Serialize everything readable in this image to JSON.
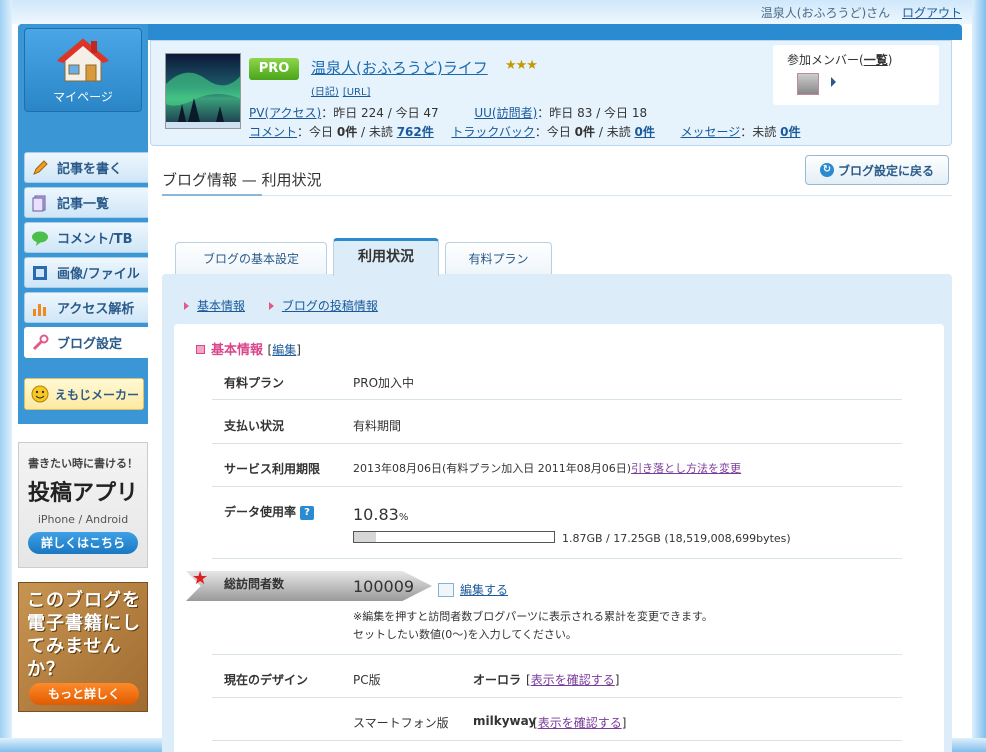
{
  "user": {
    "name": "温泉人(おふろうど)さん",
    "logout": "ログアウト"
  },
  "sidebar": {
    "mypage": "マイページ",
    "items": [
      {
        "label": "記事を書く",
        "icon": "pencil-icon"
      },
      {
        "label": "記事一覧",
        "icon": "document-icon"
      },
      {
        "label": "コメント/TB",
        "icon": "speech-bubble-icon"
      },
      {
        "label": "画像/ファイル",
        "icon": "image-icon"
      },
      {
        "label": "アクセス解析",
        "icon": "bar-chart-icon"
      },
      {
        "label": "ブログ設定",
        "icon": "wrench-icon"
      }
    ],
    "emoji_maker": "えもじメーカー"
  },
  "ads": {
    "app": {
      "line1": "書きたい時に書ける！",
      "line2": "投稿アプリ",
      "line3": "iPhone / Android",
      "button": "詳しくはこちら"
    },
    "ebook": {
      "text": "このブログを電子書籍にしてみませんか？",
      "button": "もっと詳しく"
    }
  },
  "header": {
    "badge": "PRO",
    "blog_title": "温泉人(おふろうど)ライフ",
    "stars": "★★★",
    "sublink_diary": "(日記)",
    "sublink_url": "[URL]",
    "pv_label": "PV(アクセス)",
    "pv_text": "：昨日 224 / 今日 47",
    "uu_label": "UU(訪問者)",
    "uu_text": "：昨日 83 / 今日 18",
    "comment_label": "コメント",
    "comment_text": "：今日 ",
    "comment_today": "0件",
    "comment_unread_text": " / 未読 ",
    "comment_unread": "762件",
    "trackback_label": "トラックバック",
    "trackback_text": "：今日 ",
    "trackback_today": "0件",
    "trackback_unread_text": " / 未読 ",
    "trackback_unread": "0件",
    "message_label": "メッセージ",
    "message_text": "：未読 ",
    "message_unread": "0件",
    "members_label": "参加メンバー(",
    "members_link": "一覧",
    "members_close": ")"
  },
  "page": {
    "title": "ブログ情報 — 利用状況",
    "back_button": "ブログ設定に戻る",
    "tabs": [
      {
        "label": "ブログの基本設定"
      },
      {
        "label": "利用状況"
      },
      {
        "label": "有料プラン"
      }
    ],
    "breadcrumbs": [
      {
        "label": "基本情報"
      },
      {
        "label": "ブログの投稿情報"
      }
    ]
  },
  "basic_info": {
    "section_title": "基本情報",
    "edit_label": "編集",
    "plan_label": "有料プラン",
    "plan_value": "PRO加入中",
    "payment_label": "支払い状況",
    "payment_value": "有料期間",
    "period_label": "サービス利用期限",
    "period_value": "2013年08月06日(有料プラン加入日 2011年08月06日)",
    "period_link": "引き落とし方法を変更",
    "data_label": "データ使用率",
    "data_percent": "10.83",
    "data_percent_unit": "%",
    "data_fraction": 0.1083,
    "data_usage": "1.87GB / 17.25GB (18,519,008,699bytes)",
    "visitors_label": "総訪問者数",
    "visitors_value": "100009",
    "visitors_edit": "編集する",
    "visitors_note1": "※編集を押すと訪問者数ブログパーツに表示される累計を変更できます。",
    "visitors_note2": "セットしたい数値(0〜)を入力してください。",
    "design_label": "現在のデザイン",
    "design_pc_label": "PC版",
    "design_pc_name": "オーロラ",
    "design_sp_label": "スマートフォン版",
    "design_sp_name": "milkyway",
    "design_confirm": "表示を確認する"
  },
  "colors": {
    "sidebar_blue": "#3b96d6",
    "accent_blue": "#2a8bd0",
    "pro_green": "#4aa41a",
    "section_pink": "#d9478a"
  }
}
